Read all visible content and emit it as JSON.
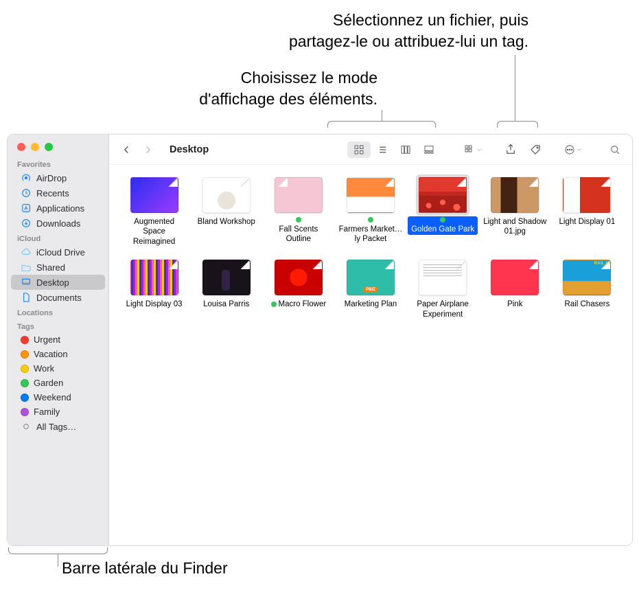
{
  "annotations": {
    "share_tag": "Sélectionnez un fichier, puis\npartagez-le ou attribuez-lui un tag.",
    "view_mode": "Choisissez le mode\nd'affichage des éléments.",
    "sidebar": "Barre latérale du Finder"
  },
  "toolbar": {
    "title": "Desktop"
  },
  "sidebar": {
    "sections": {
      "favorites": {
        "label": "Favorites",
        "items": [
          {
            "icon": "airdrop",
            "label": "AirDrop"
          },
          {
            "icon": "recents",
            "label": "Recents"
          },
          {
            "icon": "apps",
            "label": "Applications"
          },
          {
            "icon": "downloads",
            "label": "Downloads"
          }
        ]
      },
      "icloud": {
        "label": "iCloud",
        "items": [
          {
            "icon": "cloud",
            "label": "iCloud Drive"
          },
          {
            "icon": "shared",
            "label": "Shared"
          },
          {
            "icon": "desktop",
            "label": "Desktop",
            "selected": true
          },
          {
            "icon": "doc",
            "label": "Documents"
          }
        ]
      },
      "locations": {
        "label": "Locations"
      },
      "tags": {
        "label": "Tags",
        "items": [
          {
            "color": "#ff3b30",
            "label": "Urgent"
          },
          {
            "color": "#ff9500",
            "label": "Vacation"
          },
          {
            "color": "#ffcc00",
            "label": "Work"
          },
          {
            "color": "#34c759",
            "label": "Garden"
          },
          {
            "color": "#007aff",
            "label": "Weekend"
          },
          {
            "color": "#af52de",
            "label": "Family"
          }
        ],
        "all_label": "All Tags…"
      }
    }
  },
  "files": [
    {
      "label": "Augmented Space Reimagined",
      "thumb": "th-augmented"
    },
    {
      "label": "Bland Workshop",
      "thumb": "th-bland"
    },
    {
      "label": "Fall Scents Outline",
      "thumb": "th-fall",
      "tag": "#34c759"
    },
    {
      "label": "Farmers Market…ly Packet",
      "thumb": "th-farmers",
      "tag": "#34c759"
    },
    {
      "label": "Golden Gate Park",
      "thumb": "th-golden",
      "tag": "#34c759",
      "selected": true
    },
    {
      "label": "Light and Shadow 01.jpg",
      "thumb": "th-lightshadow"
    },
    {
      "label": "Light Display 01",
      "thumb": "th-lightdisp01"
    },
    {
      "label": "Light Display 03",
      "thumb": "th-lightdisp03"
    },
    {
      "label": "Louisa Parris",
      "thumb": "th-louisa"
    },
    {
      "label": "Macro Flower",
      "thumb": "th-macro",
      "tag": "#34c759"
    },
    {
      "label": "Marketing Plan",
      "thumb": "th-marketing"
    },
    {
      "label": "Paper Airplane Experiment",
      "thumb": "th-paper"
    },
    {
      "label": "Pink",
      "thumb": "th-pink"
    },
    {
      "label": "Rail Chasers",
      "thumb": "th-rail"
    }
  ]
}
